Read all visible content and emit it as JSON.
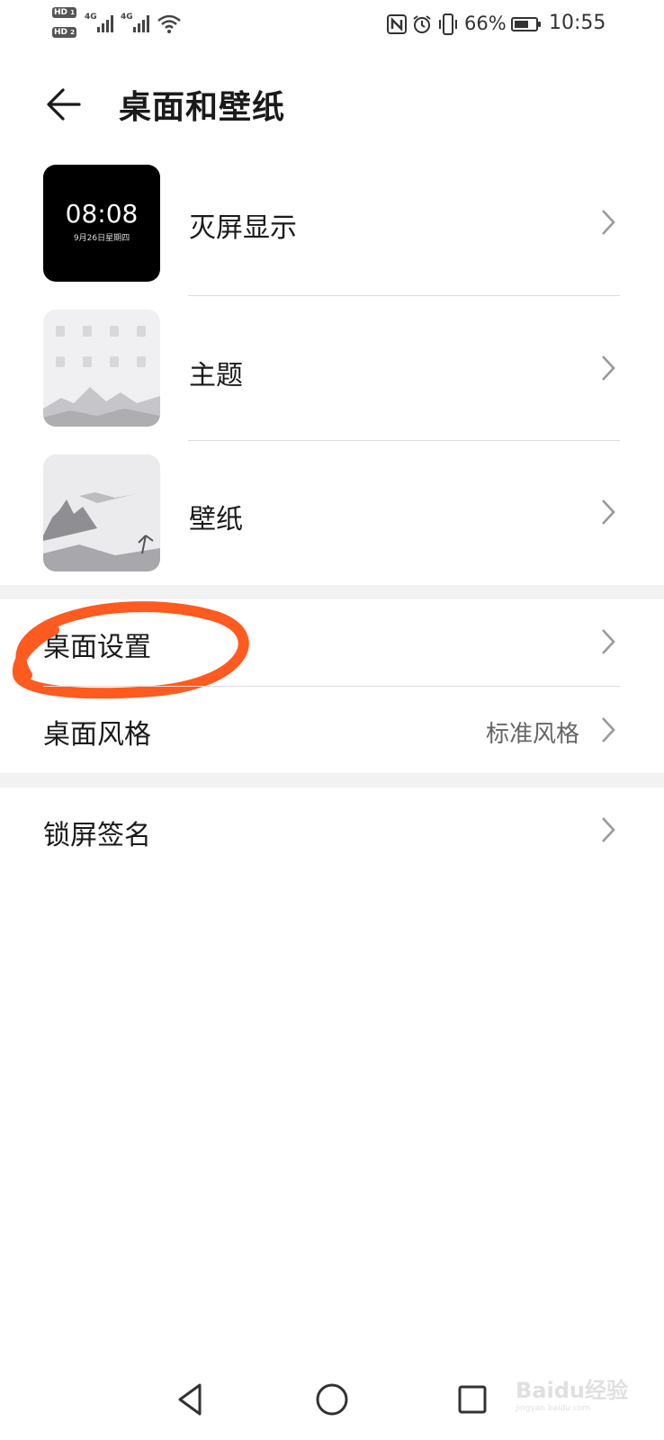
{
  "status_bar": {
    "hd1": "HD",
    "hd1_sub": "1",
    "hd2": "HD",
    "hd2_sub": "2",
    "net1": "4G",
    "net2": "4G",
    "battery_percent": "66%",
    "battery_level": 0.66,
    "time": "10:55"
  },
  "header": {
    "title": "桌面和壁纸"
  },
  "items": {
    "aod": {
      "label": "灭屏显示",
      "preview_time": "08:08",
      "preview_date": "9月26日星期四"
    },
    "theme": {
      "label": "主题"
    },
    "wallpaper": {
      "label": "壁纸"
    },
    "desktop_settings": {
      "label": "桌面设置"
    },
    "desktop_style": {
      "label": "桌面风格",
      "value": "标准风格"
    },
    "lock_signature": {
      "label": "锁屏签名"
    }
  },
  "annotation": {
    "color": "#ff5a1f"
  },
  "watermark": {
    "brand": "Baidu经验",
    "url": "jingyan.baidu.com"
  },
  "colors": {
    "background": "#ffffff",
    "divider": "#dcdcdc",
    "section_gap": "#f2f2f2",
    "chevron": "#9a9a9a"
  }
}
